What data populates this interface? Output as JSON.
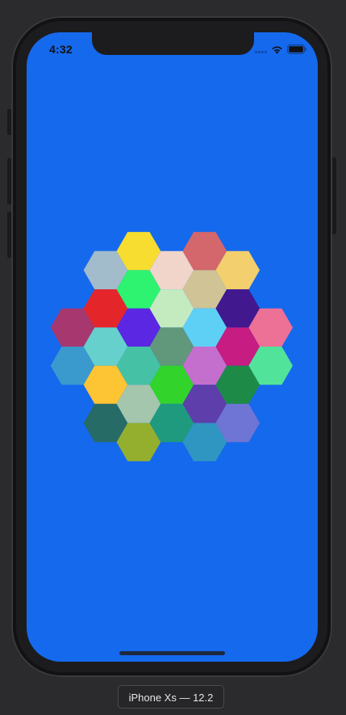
{
  "status_bar": {
    "time": "4:32",
    "signal_icon": "cellular-signal-icon",
    "wifi_icon": "wifi-icon",
    "battery_icon": "battery-icon"
  },
  "screen": {
    "background_color": "#1569ed"
  },
  "hex_grid": {
    "columns": [
      [
        "#a7386f",
        "#3a99cd"
      ],
      [
        "#a3bccb",
        "#e4262b",
        "#66d0cc",
        "#fdc433",
        "#266b66"
      ],
      [
        "#f7dd2f",
        "#2ef370",
        "#5b27e2",
        "#45c2a5",
        "#a4c6ad",
        "#94af2e"
      ],
      [
        "#f1d4ca",
        "#c4ebc0",
        "#61977a",
        "#32d42b",
        "#1f9a7e"
      ],
      [
        "#d4676b",
        "#d0c396",
        "#5ed0f6",
        "#c46fcd",
        "#5e3eab",
        "#2f96c1"
      ],
      [
        "#f3cf6d",
        "#42188f",
        "#c71c81",
        "#1e8a48",
        "#6f75d4"
      ],
      [
        "#ed7096",
        "#52e39a"
      ]
    ]
  },
  "simulator_label": "iPhone Xs — 12.2"
}
